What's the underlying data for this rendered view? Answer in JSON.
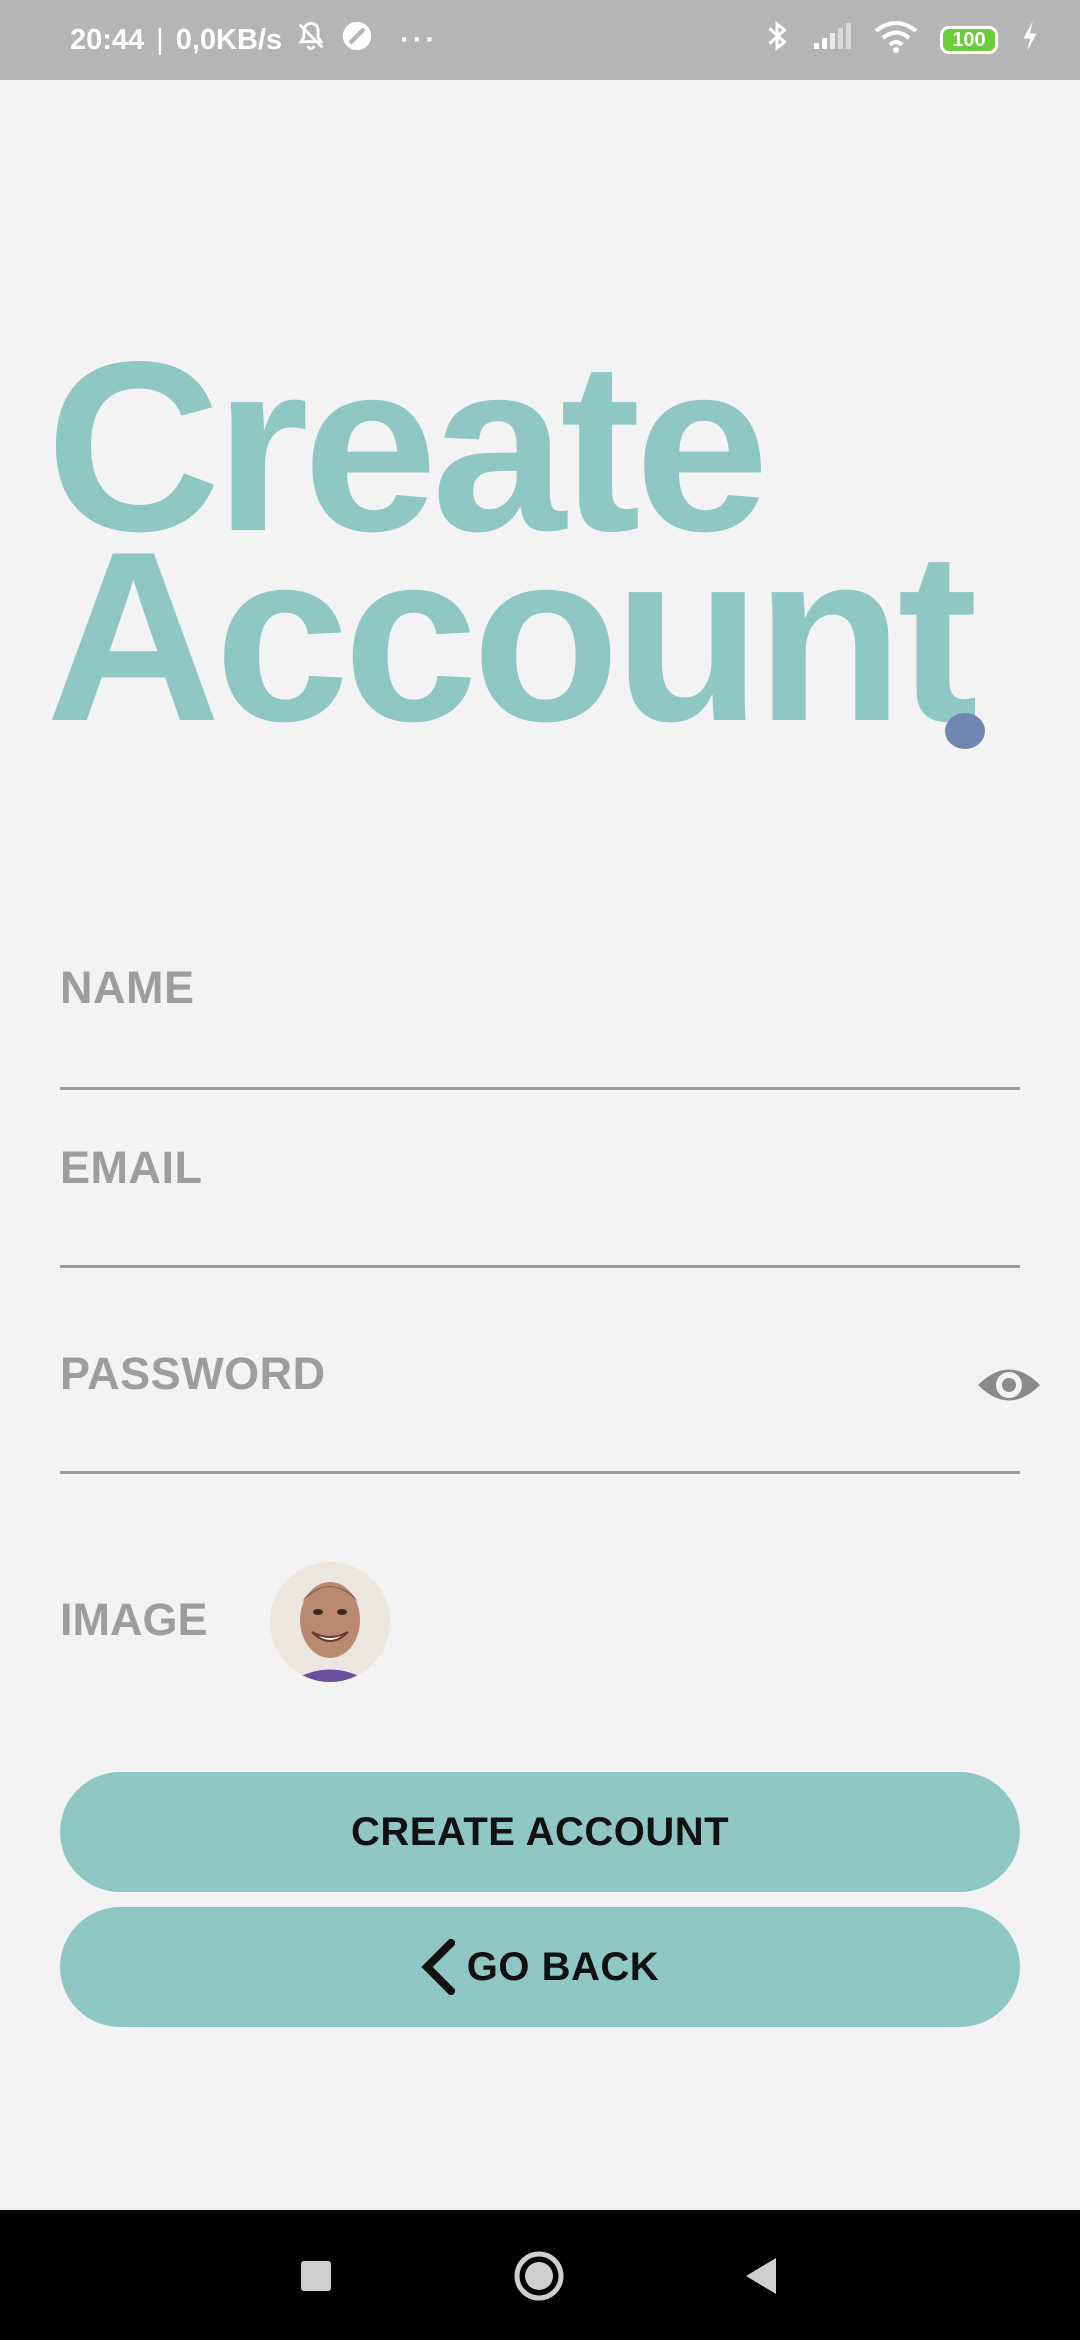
{
  "status_bar": {
    "time": "20:44",
    "separator": "|",
    "network_speed": "0,0KB/s",
    "more": "···",
    "battery": "100",
    "icons": [
      "bell-off-icon",
      "dnd-icon",
      "bluetooth-icon",
      "signal-icon",
      "wifi-icon",
      "battery-icon",
      "charging-icon"
    ]
  },
  "headline": {
    "line1": "Create",
    "line2": "Account"
  },
  "form": {
    "name_label": "NAME",
    "email_label": "EMAIL",
    "password_label": "PASSWORD",
    "image_label": "IMAGE"
  },
  "buttons": {
    "create_account": "CREATE ACCOUNT",
    "go_back": "GO BACK"
  },
  "colors": {
    "accent": "#8fc7c5",
    "dot": "#6f86b0",
    "label": "#9d9d9d",
    "background": "#f3f3f3",
    "status_bar": "#b5b5b5"
  }
}
